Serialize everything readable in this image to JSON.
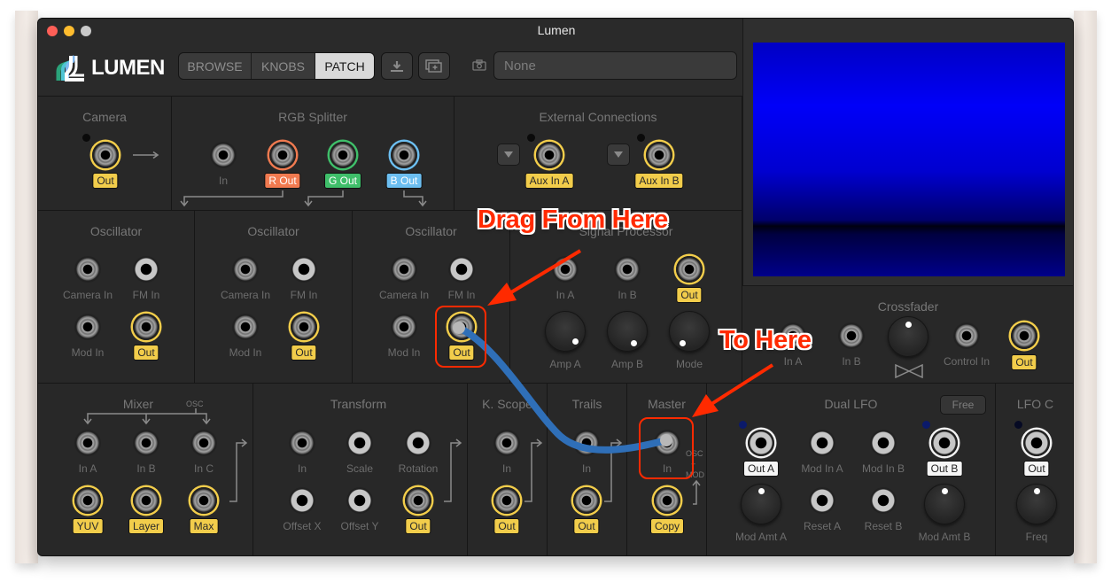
{
  "window": {
    "title": "Lumen"
  },
  "app": {
    "logo_text": "LUMEN"
  },
  "toolbar": {
    "modes": [
      {
        "label": "BROWSE",
        "active": false
      },
      {
        "label": "KNOBS",
        "active": false
      },
      {
        "label": "PATCH",
        "active": true
      }
    ],
    "save_icon": "download-icon",
    "add_window_icon": "add-window-icon",
    "camera_icon": "camera-icon",
    "source_value": "None"
  },
  "modules": {
    "camera": {
      "title": "Camera",
      "out": "Out"
    },
    "rgb_splitter": {
      "title": "RGB Splitter",
      "in": "In",
      "r_out": "R Out",
      "g_out": "G Out",
      "b_out": "B Out"
    },
    "external": {
      "title": "External Connections",
      "aux_a": "Aux In A",
      "aux_b": "Aux In B"
    },
    "osc1": {
      "title": "Oscillator",
      "camera_in": "Camera In",
      "fm_in": "FM In",
      "mod_in": "Mod In",
      "out": "Out"
    },
    "osc2": {
      "title": "Oscillator",
      "camera_in": "Camera In",
      "fm_in": "FM In",
      "mod_in": "Mod In",
      "out": "Out"
    },
    "osc3": {
      "title": "Oscillator",
      "camera_in": "Camera In",
      "fm_in": "FM In",
      "mod_in": "Mod In",
      "out": "Out"
    },
    "signal_processor": {
      "title": "Signal Processor",
      "in_a": "In A",
      "in_b": "In B",
      "out": "Out",
      "amp_a": "Amp A",
      "amp_b": "Amp B",
      "mode": "Mode"
    },
    "crossfader": {
      "title": "Crossfader",
      "in_a": "In A",
      "in_b": "In B",
      "control_in": "Control In",
      "out": "Out"
    },
    "mixer": {
      "title": "Mixer",
      "osc_label": "OSC",
      "in_a": "In A",
      "in_b": "In B",
      "in_c": "In C",
      "yuv": "YUV",
      "layer": "Layer",
      "max": "Max"
    },
    "transform": {
      "title": "Transform",
      "in": "In",
      "scale": "Scale",
      "rotation": "Rotation",
      "offset_x": "Offset X",
      "offset_y": "Offset Y",
      "out": "Out"
    },
    "kscope": {
      "title": "K. Scope",
      "in": "In",
      "out": "Out"
    },
    "trails": {
      "title": "Trails",
      "in": "In",
      "out": "Out"
    },
    "master": {
      "title": "Master",
      "in": "In",
      "copy": "Copy",
      "side_top": "OSC",
      "side_mid": "+",
      "side_bot": "MOD"
    },
    "dual_lfo": {
      "title": "Dual LFO",
      "free_label": "Free",
      "out_a": "Out A",
      "mod_in_a": "Mod In A",
      "mod_in_b": "Mod In B",
      "out_b": "Out B",
      "reset_a": "Reset A",
      "reset_b": "Reset B",
      "mod_amt_a": "Mod Amt A",
      "mod_amt_b": "Mod Amt B"
    },
    "lfo_c": {
      "title": "LFO C",
      "out": "Out",
      "freq": "Freq"
    }
  },
  "annotations": {
    "drag_from": "Drag From Here",
    "to_here": "To Here"
  },
  "colors": {
    "output_ring": "#f2cd4b",
    "red": "#f07a50",
    "green": "#3fbf6a",
    "blue": "#6cbef0",
    "cable": "#2f6fb8",
    "annotation": "#ff2a00"
  }
}
